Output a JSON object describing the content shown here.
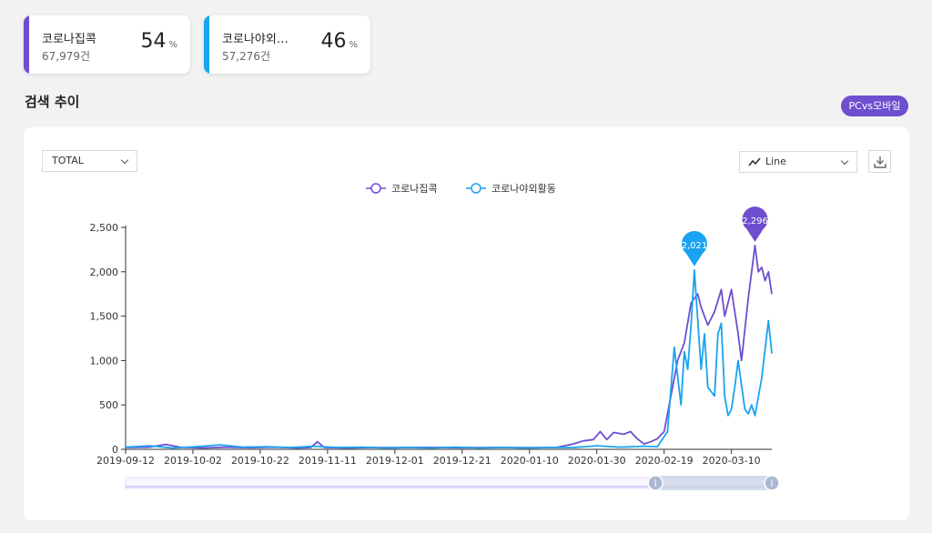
{
  "cards": [
    {
      "name": "코로나집콕",
      "count": "67,979건",
      "percent": "54",
      "unit": "%",
      "color": "#6d4fcf"
    },
    {
      "name": "코로나야외…",
      "count": "57,276건",
      "percent": "46",
      "unit": "%",
      "color": "#1aa3f0"
    }
  ],
  "section_title": "검색 추이",
  "pc_mobile_button": "PCvs모바일",
  "filter_select": "TOTAL",
  "chart_type_select": "Line",
  "icons": {
    "download": "download-icon",
    "line": "line-chart-icon",
    "chevron": "chevron-down-icon"
  },
  "chart_data": {
    "type": "line",
    "legend": [
      "코로나집콕",
      "코로나야외활동"
    ],
    "legend_position": "top-center",
    "x_ticks": [
      "2019-09-12",
      "2019-10-02",
      "2019-10-22",
      "2019-11-11",
      "2019-12-01",
      "2019-12-21",
      "2020-01-10",
      "2020-01-30",
      "2020-02-19",
      "2020-03-10"
    ],
    "y_ticks": [
      "0",
      "500",
      "1,000",
      "1,500",
      "2,000",
      "2,500"
    ],
    "ylim": [
      0,
      2500
    ],
    "x_range": [
      "2019-09-12",
      "2020-03-22"
    ],
    "grid": false,
    "series": [
      {
        "name": "코로나집콕",
        "color": "#6d4fcf",
        "points": [
          [
            "2019-09-12",
            20
          ],
          [
            "2019-09-19",
            25
          ],
          [
            "2019-09-24",
            55
          ],
          [
            "2019-09-28",
            25
          ],
          [
            "2019-10-05",
            15
          ],
          [
            "2019-10-12",
            25
          ],
          [
            "2019-10-19",
            18
          ],
          [
            "2019-10-26",
            25
          ],
          [
            "2019-11-02",
            15
          ],
          [
            "2019-11-06",
            20
          ],
          [
            "2019-11-08",
            85
          ],
          [
            "2019-11-10",
            20
          ],
          [
            "2019-11-17",
            15
          ],
          [
            "2019-11-24",
            20
          ],
          [
            "2019-12-01",
            18
          ],
          [
            "2019-12-10",
            22
          ],
          [
            "2019-12-20",
            18
          ],
          [
            "2019-12-30",
            20
          ],
          [
            "2020-01-10",
            18
          ],
          [
            "2020-01-18",
            20
          ],
          [
            "2020-01-23",
            60
          ],
          [
            "2020-01-26",
            95
          ],
          [
            "2020-01-29",
            110
          ],
          [
            "2020-01-31",
            200
          ],
          [
            "2020-02-02",
            110
          ],
          [
            "2020-02-04",
            190
          ],
          [
            "2020-02-07",
            170
          ],
          [
            "2020-02-09",
            200
          ],
          [
            "2020-02-11",
            120
          ],
          [
            "2020-02-13",
            60
          ],
          [
            "2020-02-15",
            85
          ],
          [
            "2020-02-17",
            120
          ],
          [
            "2020-02-19",
            200
          ],
          [
            "2020-02-21",
            600
          ],
          [
            "2020-02-23",
            1000
          ],
          [
            "2020-02-25",
            1200
          ],
          [
            "2020-02-27",
            1650
          ],
          [
            "2020-02-28",
            1700
          ],
          [
            "2020-02-29",
            1750
          ],
          [
            "2020-03-01",
            1600
          ],
          [
            "2020-03-03",
            1400
          ],
          [
            "2020-03-05",
            1550
          ],
          [
            "2020-03-07",
            1800
          ],
          [
            "2020-03-08",
            1500
          ],
          [
            "2020-03-10",
            1800
          ],
          [
            "2020-03-12",
            1300
          ],
          [
            "2020-03-13",
            1000
          ],
          [
            "2020-03-15",
            1700
          ],
          [
            "2020-03-17",
            2296
          ],
          [
            "2020-03-18",
            2000
          ],
          [
            "2020-03-19",
            2050
          ],
          [
            "2020-03-20",
            1900
          ],
          [
            "2020-03-21",
            2000
          ],
          [
            "2020-03-22",
            1750
          ]
        ]
      },
      {
        "name": "코로나야외활동",
        "color": "#1aa3f0",
        "points": [
          [
            "2019-09-12",
            25
          ],
          [
            "2019-09-19",
            40
          ],
          [
            "2019-09-26",
            15
          ],
          [
            "2019-10-03",
            30
          ],
          [
            "2019-10-10",
            50
          ],
          [
            "2019-10-17",
            25
          ],
          [
            "2019-10-24",
            30
          ],
          [
            "2019-10-31",
            20
          ],
          [
            "2019-11-07",
            35
          ],
          [
            "2019-11-14",
            20
          ],
          [
            "2019-11-21",
            25
          ],
          [
            "2019-11-28",
            15
          ],
          [
            "2019-12-05",
            20
          ],
          [
            "2019-12-12",
            15
          ],
          [
            "2019-12-19",
            25
          ],
          [
            "2019-12-26",
            15
          ],
          [
            "2020-01-02",
            20
          ],
          [
            "2020-01-09",
            15
          ],
          [
            "2020-01-16",
            20
          ],
          [
            "2020-01-23",
            20
          ],
          [
            "2020-01-30",
            40
          ],
          [
            "2020-02-06",
            25
          ],
          [
            "2020-02-13",
            35
          ],
          [
            "2020-02-17",
            30
          ],
          [
            "2020-02-20",
            200
          ],
          [
            "2020-02-22",
            1150
          ],
          [
            "2020-02-24",
            500
          ],
          [
            "2020-02-25",
            1100
          ],
          [
            "2020-02-26",
            900
          ],
          [
            "2020-02-27",
            1400
          ],
          [
            "2020-02-28",
            2021
          ],
          [
            "2020-03-01",
            900
          ],
          [
            "2020-03-02",
            1300
          ],
          [
            "2020-03-03",
            700
          ],
          [
            "2020-03-05",
            600
          ],
          [
            "2020-03-06",
            1300
          ],
          [
            "2020-03-07",
            1420
          ],
          [
            "2020-03-08",
            600
          ],
          [
            "2020-03-09",
            380
          ],
          [
            "2020-03-10",
            450
          ],
          [
            "2020-03-11",
            700
          ],
          [
            "2020-03-12",
            1000
          ],
          [
            "2020-03-14",
            450
          ],
          [
            "2020-03-15",
            400
          ],
          [
            "2020-03-16",
            500
          ],
          [
            "2020-03-17",
            380
          ],
          [
            "2020-03-19",
            800
          ],
          [
            "2020-03-21",
            1450
          ],
          [
            "2020-03-22",
            1080
          ]
        ]
      }
    ],
    "annotations": [
      {
        "series": "코로나집콕",
        "label": "2,296",
        "x": "2020-03-17",
        "y": 2296
      },
      {
        "series": "코로나야외활동",
        "label": "2,021",
        "x": "2020-02-28",
        "y": 2021
      }
    ],
    "zoom_slider": {
      "start_fraction": 0.82,
      "end_fraction": 1.0
    }
  }
}
